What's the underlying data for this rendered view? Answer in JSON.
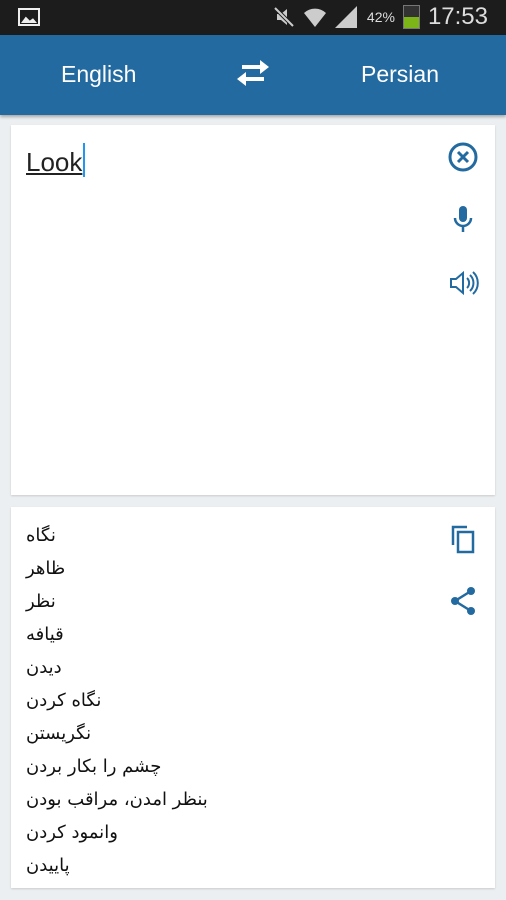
{
  "status_bar": {
    "battery": "42%",
    "time": "17:53"
  },
  "header": {
    "source_language": "English",
    "target_language": "Persian",
    "swap_icon": "swap-arrows-icon"
  },
  "input": {
    "text": "Look",
    "icons": [
      "clear-icon",
      "microphone-icon",
      "speaker-icon"
    ]
  },
  "output": {
    "translations": [
      "نگاه",
      "ظاهر",
      "نظر",
      "قیافه",
      "دیدن",
      "نگاه کردن",
      "نگریستن",
      "چشم را بکار بردن",
      "بنظر امدن، مراقب بودن",
      "وانمود کردن",
      "پاییدن"
    ],
    "icons": [
      "copy-icon",
      "share-icon"
    ]
  },
  "colors": {
    "accent": "#236aa0",
    "status_bar": "#1c1c1c",
    "background": "#eceff1"
  }
}
